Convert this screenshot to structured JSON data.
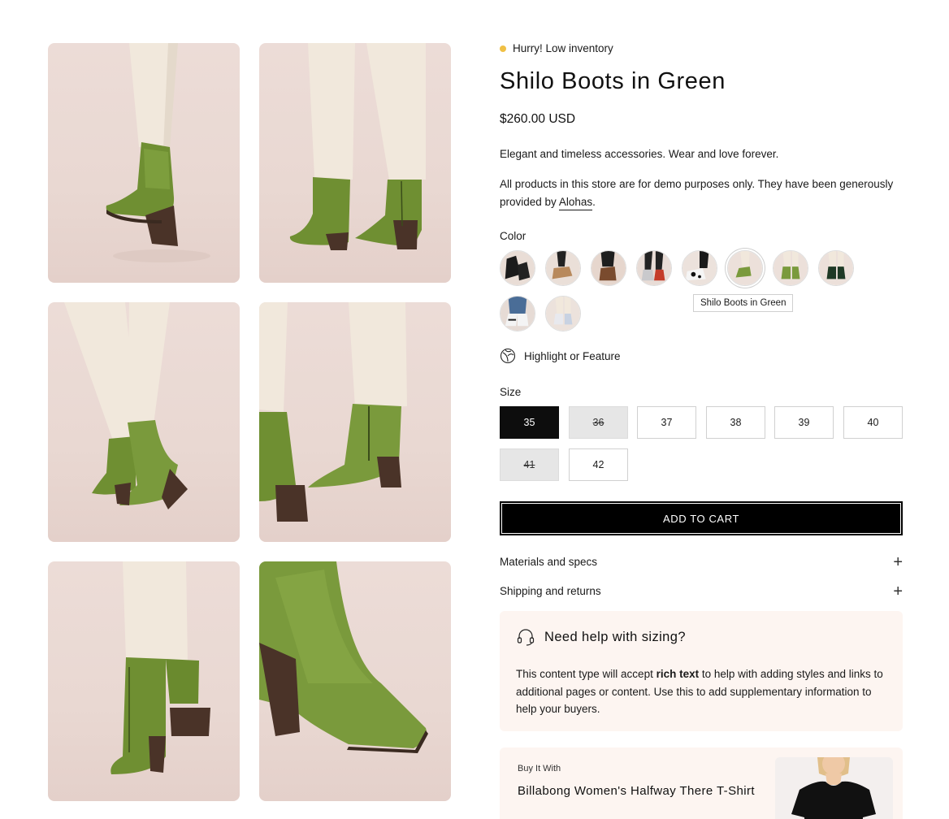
{
  "product": {
    "stock_status": "Hurry! Low inventory",
    "title": "Shilo Boots in Green",
    "price": "$260.00 USD",
    "description": "Elegant and timeless accessories. Wear and love forever.",
    "disclaimer_prefix": "All products in this store are for demo purposes only. They have been generously provided by ",
    "disclaimer_link": "Alohas",
    "disclaimer_suffix": "."
  },
  "color": {
    "label": "Color",
    "tooltip": "Shilo Boots in Green",
    "swatches": [
      "black",
      "tan",
      "brown",
      "silver",
      "cow-print",
      "green",
      "green",
      "dark-green",
      "denim-white",
      "white-blue"
    ],
    "selected_index": 5
  },
  "feature": {
    "label": "Highlight or Feature",
    "icon": "leaf-globe-icon"
  },
  "size": {
    "label": "Size",
    "options": [
      "35",
      "36",
      "37",
      "38",
      "39",
      "40",
      "41",
      "42"
    ],
    "selected": "35",
    "sold_out": [
      "36",
      "41"
    ]
  },
  "cart": {
    "label": "ADD TO CART"
  },
  "accordions": [
    {
      "label": "Materials and specs"
    },
    {
      "label": "Shipping and returns"
    }
  ],
  "help": {
    "title": "Need help with sizing?",
    "body_prefix": "This content type will accept ",
    "body_bold": "rich text",
    "body_suffix": " to help with adding styles and links to additional pages or content. Use this to add supplementary information to help your buyers."
  },
  "bundle": {
    "eyebrow": "Buy It With",
    "product_name": "Billabong Women's Halfway There T-Shirt"
  },
  "colors": {
    "stock_dot": "#f0c045",
    "boot_green": "#7a9a3c",
    "heel_brown": "#4a3328",
    "panel_bg": "#fdf5f1",
    "button_bg": "#000000"
  }
}
